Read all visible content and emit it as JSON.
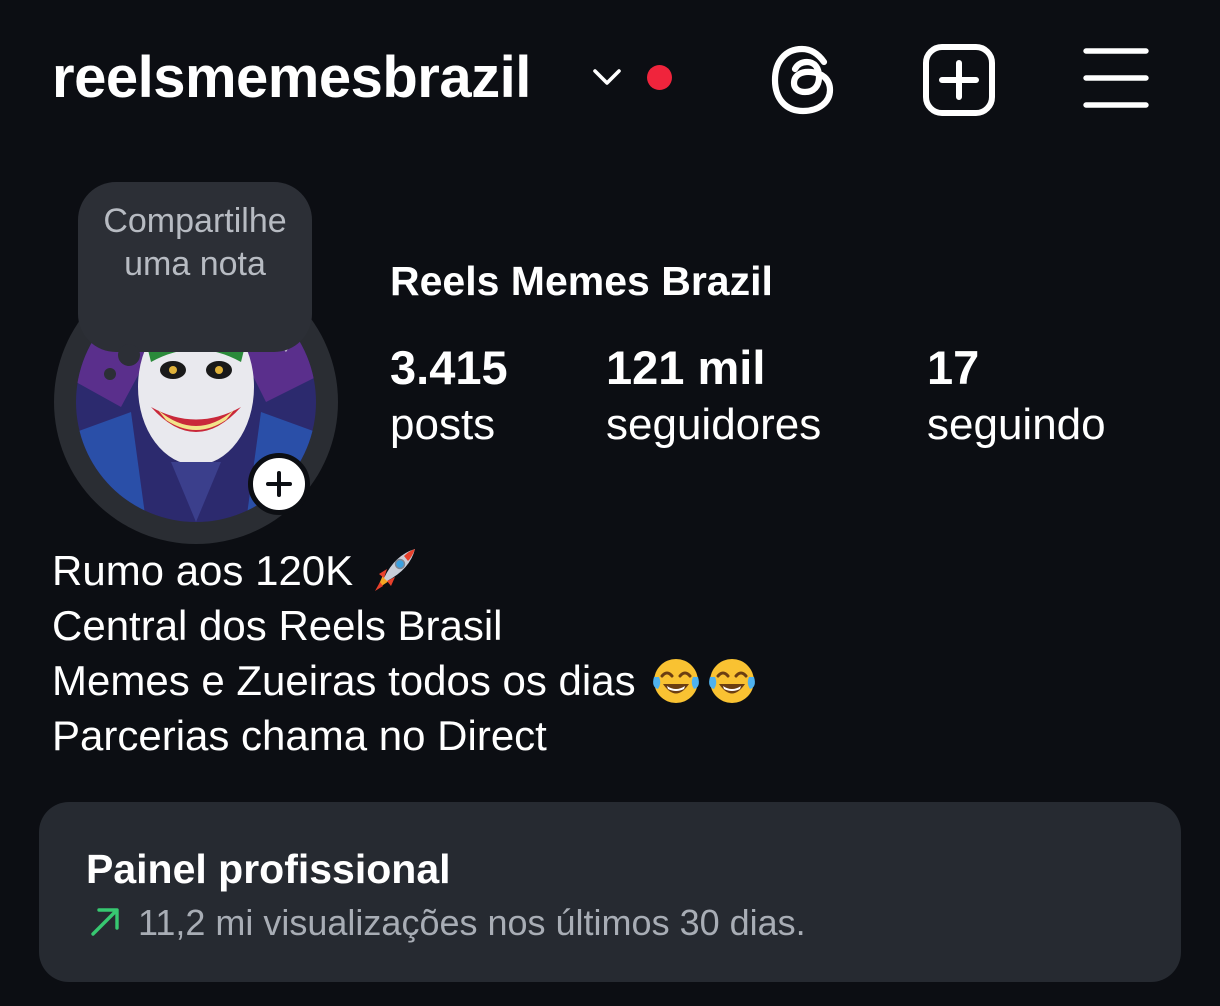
{
  "header": {
    "username": "reelsmemesbrazil",
    "account_switcher_icon": "chevron-down-icon",
    "notification_dot_color": "#f0243c",
    "threads_icon": "threads-icon",
    "create_icon": "plus-square-icon",
    "menu_icon": "hamburger-menu-icon"
  },
  "note": {
    "placeholder": "Compartilhe uma nota"
  },
  "profile": {
    "display_name": "Reels Memes Brazil",
    "avatar_icon": "profile-picture",
    "add_story_icon": "plus-icon"
  },
  "stats": [
    {
      "value": "3.415",
      "label": "posts"
    },
    {
      "value": "121 mil",
      "label": "seguidores"
    },
    {
      "value": "17",
      "label": "seguindo"
    }
  ],
  "bio": {
    "line1": "Rumo aos 120K",
    "line1_emoji": "rocket",
    "line2": "Central dos Reels Brasil",
    "line3": "Memes e Zueiras todos os dias",
    "line3_emoji": "face-with-tears-of-joy",
    "line4": "Parcerias chama no Direct"
  },
  "professional_dashboard": {
    "title": "Painel profissional",
    "trend_icon": "trending-up-arrow-icon",
    "trend_color": "#37c871",
    "subtitle": "11,2 mi visualizações nos últimos 30 dias."
  }
}
